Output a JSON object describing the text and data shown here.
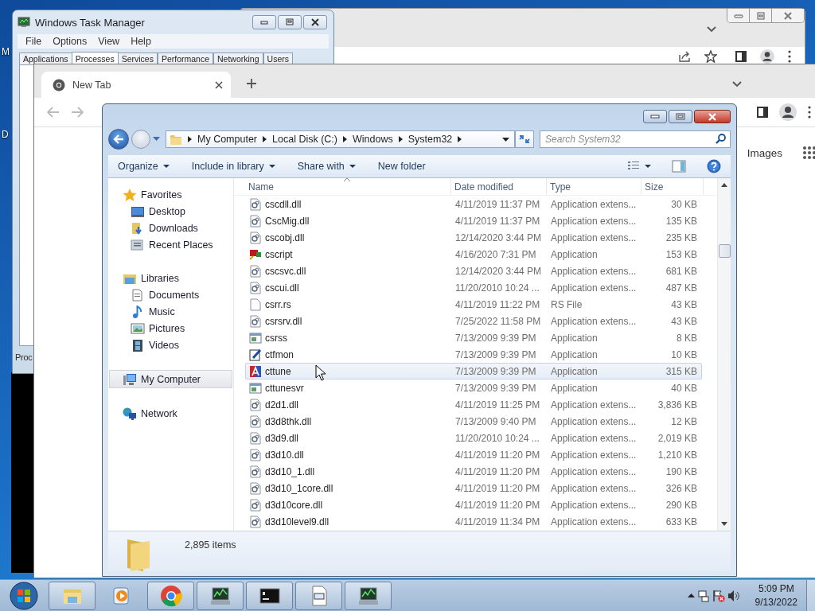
{
  "desktop": {
    "icon_labels": [
      "M",
      "D"
    ]
  },
  "task_manager": {
    "title": "Windows Task Manager",
    "menu": [
      "File",
      "Options",
      "View",
      "Help"
    ],
    "tabs": [
      {
        "label": "Applications",
        "selected": false
      },
      {
        "label": "Processes",
        "selected": true
      },
      {
        "label": "Services",
        "selected": false
      },
      {
        "label": "Performance",
        "selected": false
      },
      {
        "label": "Networking",
        "selected": false
      },
      {
        "label": "Users",
        "selected": false
      }
    ],
    "status": "Proc"
  },
  "browser": {
    "tab": {
      "title": "New Tab"
    },
    "links": [
      "Images"
    ]
  },
  "explorer": {
    "breadcrumb": [
      "My Computer",
      "Local Disk (C:)",
      "Windows",
      "System32"
    ],
    "search": {
      "placeholder": "Search System32"
    },
    "commands": [
      {
        "label": "Organize",
        "dropdown": true
      },
      {
        "label": "Include in library",
        "dropdown": true
      },
      {
        "label": "Share with",
        "dropdown": true
      },
      {
        "label": "New folder",
        "dropdown": false
      }
    ],
    "nav": [
      {
        "label": "Favorites",
        "kind": "star",
        "selected": false,
        "children": [
          {
            "label": "Desktop",
            "kind": "desktop",
            "selected": false
          },
          {
            "label": "Downloads",
            "kind": "downloads",
            "selected": false
          },
          {
            "label": "Recent Places",
            "kind": "recent",
            "selected": false
          }
        ]
      },
      {
        "label": "Libraries",
        "kind": "library",
        "selected": false,
        "children": [
          {
            "label": "Documents",
            "kind": "documents",
            "selected": false
          },
          {
            "label": "Music",
            "kind": "music",
            "selected": false
          },
          {
            "label": "Pictures",
            "kind": "pictures",
            "selected": false
          },
          {
            "label": "Videos",
            "kind": "videos",
            "selected": false
          }
        ]
      },
      {
        "label": "My Computer",
        "kind": "computer",
        "selected": true
      },
      {
        "label": "Network",
        "kind": "network",
        "selected": false
      }
    ],
    "columns": [
      {
        "label": "Name",
        "sorted": true
      },
      {
        "label": "Date modified",
        "sorted": false
      },
      {
        "label": "Type",
        "sorted": false
      },
      {
        "label": "Size",
        "sorted": false
      }
    ],
    "rows": [
      {
        "name": "cscdll.dll",
        "date": "4/11/2019 11:37 PM",
        "type": "Application extens...",
        "size": "30 KB",
        "kind": "dll",
        "selected": false
      },
      {
        "name": "CscMig.dll",
        "date": "4/11/2019 11:37 PM",
        "type": "Application extens...",
        "size": "135 KB",
        "kind": "dll",
        "selected": false
      },
      {
        "name": "cscobj.dll",
        "date": "12/14/2020 3:44 PM",
        "type": "Application extens...",
        "size": "235 KB",
        "kind": "dll",
        "selected": false
      },
      {
        "name": "cscript",
        "date": "4/16/2020 7:31 PM",
        "type": "Application",
        "size": "153 KB",
        "kind": "script",
        "selected": false
      },
      {
        "name": "cscsvc.dll",
        "date": "12/14/2020 3:44 PM",
        "type": "Application extens...",
        "size": "681 KB",
        "kind": "dll",
        "selected": false
      },
      {
        "name": "cscui.dll",
        "date": "11/20/2010 10:24 ...",
        "type": "Application extens...",
        "size": "487 KB",
        "kind": "dll",
        "selected": false
      },
      {
        "name": "csrr.rs",
        "date": "4/11/2019 11:22 PM",
        "type": "RS File",
        "size": "43 KB",
        "kind": "blank",
        "selected": false
      },
      {
        "name": "csrsrv.dll",
        "date": "7/25/2022 11:58 PM",
        "type": "Application extens...",
        "size": "43 KB",
        "kind": "dll",
        "selected": false
      },
      {
        "name": "csrss",
        "date": "7/13/2009 9:39 PM",
        "type": "Application",
        "size": "8 KB",
        "kind": "window",
        "selected": false
      },
      {
        "name": "ctfmon",
        "date": "7/13/2009 9:39 PM",
        "type": "Application",
        "size": "10 KB",
        "kind": "pen",
        "selected": false
      },
      {
        "name": "cttune",
        "date": "7/13/2009 9:39 PM",
        "type": "Application",
        "size": "315 KB",
        "kind": "font",
        "selected": true
      },
      {
        "name": "cttunesvr",
        "date": "7/13/2009 9:39 PM",
        "type": "Application",
        "size": "40 KB",
        "kind": "window",
        "selected": false
      },
      {
        "name": "d2d1.dll",
        "date": "4/11/2019 11:25 PM",
        "type": "Application extens...",
        "size": "3,836 KB",
        "kind": "dll",
        "selected": false
      },
      {
        "name": "d3d8thk.dll",
        "date": "7/13/2009 9:40 PM",
        "type": "Application extens...",
        "size": "12 KB",
        "kind": "dll",
        "selected": false
      },
      {
        "name": "d3d9.dll",
        "date": "11/20/2010 10:24 ...",
        "type": "Application extens...",
        "size": "2,019 KB",
        "kind": "dll",
        "selected": false
      },
      {
        "name": "d3d10.dll",
        "date": "4/11/2019 11:20 PM",
        "type": "Application extens...",
        "size": "1,210 KB",
        "kind": "dll",
        "selected": false
      },
      {
        "name": "d3d10_1.dll",
        "date": "4/11/2019 11:20 PM",
        "type": "Application extens...",
        "size": "190 KB",
        "kind": "dll",
        "selected": false
      },
      {
        "name": "d3d10_1core.dll",
        "date": "4/11/2019 11:20 PM",
        "type": "Application extens...",
        "size": "326 KB",
        "kind": "dll",
        "selected": false
      },
      {
        "name": "d3d10core.dll",
        "date": "4/11/2019 11:20 PM",
        "type": "Application extens...",
        "size": "290 KB",
        "kind": "dll",
        "selected": false
      },
      {
        "name": "d3d10level9.dll",
        "date": "4/11/2019 11:34 PM",
        "type": "Application extens...",
        "size": "633 KB",
        "kind": "dll",
        "selected": false
      }
    ],
    "status": "2,895 items"
  },
  "taskbar": {
    "apps": [
      {
        "kind": "explorer",
        "running": true
      },
      {
        "kind": "media",
        "running": false
      },
      {
        "kind": "chrome",
        "running": true
      },
      {
        "kind": "taskmgr",
        "running": true
      },
      {
        "kind": "cmd",
        "running": true
      },
      {
        "kind": "window",
        "running": true
      },
      {
        "kind": "taskmgr",
        "running": true
      }
    ],
    "time": "5:09 PM",
    "date": "9/13/2022"
  }
}
